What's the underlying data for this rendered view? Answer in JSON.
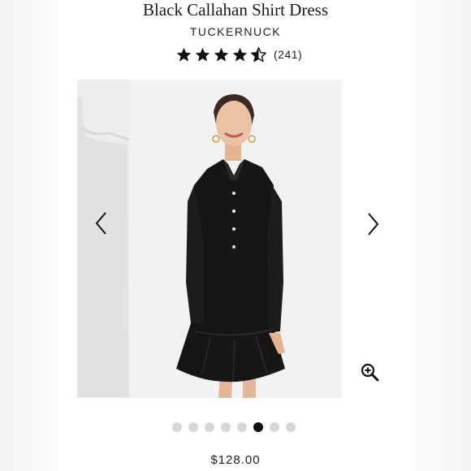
{
  "product": {
    "title": "Black Callahan Shirt Dress",
    "brand": "TUCKERNUCK",
    "rating_value": 4.5,
    "rating_count": "(241)",
    "price": "$128.00"
  },
  "gallery": {
    "total_images": 8,
    "active_index": 5,
    "prev_icon": "chevron-left-icon",
    "next_icon": "chevron-right-icon",
    "zoom_icon": "zoom-in-icon"
  },
  "colors": {
    "star": "#111111",
    "dot_inactive": "#d6d6d6",
    "dot_active": "#111111"
  }
}
